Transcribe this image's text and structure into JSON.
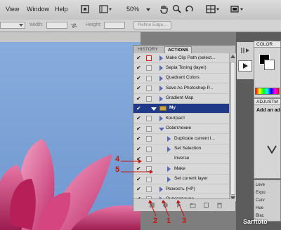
{
  "menubar": {
    "items": [
      "View",
      "Window",
      "Help"
    ],
    "zoom": "50%"
  },
  "options": {
    "width_label": "Width:",
    "height_label": "Height:",
    "refine_label": "Refine Edge..."
  },
  "panel": {
    "tabs": [
      "HISTORY",
      "ACTIONS"
    ],
    "rows": [
      {
        "label": "Make Clip Path (select..."
      },
      {
        "label": "Sepia Toning (layer)"
      },
      {
        "label": "Quadrant Colors"
      },
      {
        "label": "Save As Photoshop P..."
      },
      {
        "label": "Gradient Map"
      },
      {
        "label": "My"
      },
      {
        "label": "Контраст"
      },
      {
        "label": "Осветление"
      },
      {
        "label": "Duplicate current l..."
      },
      {
        "label": "Set Selection"
      },
      {
        "label": "Inverse"
      },
      {
        "label": "Make"
      },
      {
        "label": "Set current layer"
      },
      {
        "label": "Резкость (HP)"
      },
      {
        "label": "Оцветивание"
      }
    ]
  },
  "right": {
    "color_tab": "COLOR",
    "adj_tab": "ADJUSTM",
    "adj_text": "Add an ad",
    "lower_items": [
      "Leve",
      "Expo",
      "Curv",
      "Hue",
      "Blac"
    ]
  },
  "annotations": {
    "n1": "1",
    "n2": "2",
    "n3": "3",
    "n4": "4",
    "n5": "5"
  },
  "watermark": "Sarftoto",
  "colors": {
    "selection": "#203a8a",
    "annotation_red": "#c41414",
    "sky": "#7fa6d8"
  }
}
